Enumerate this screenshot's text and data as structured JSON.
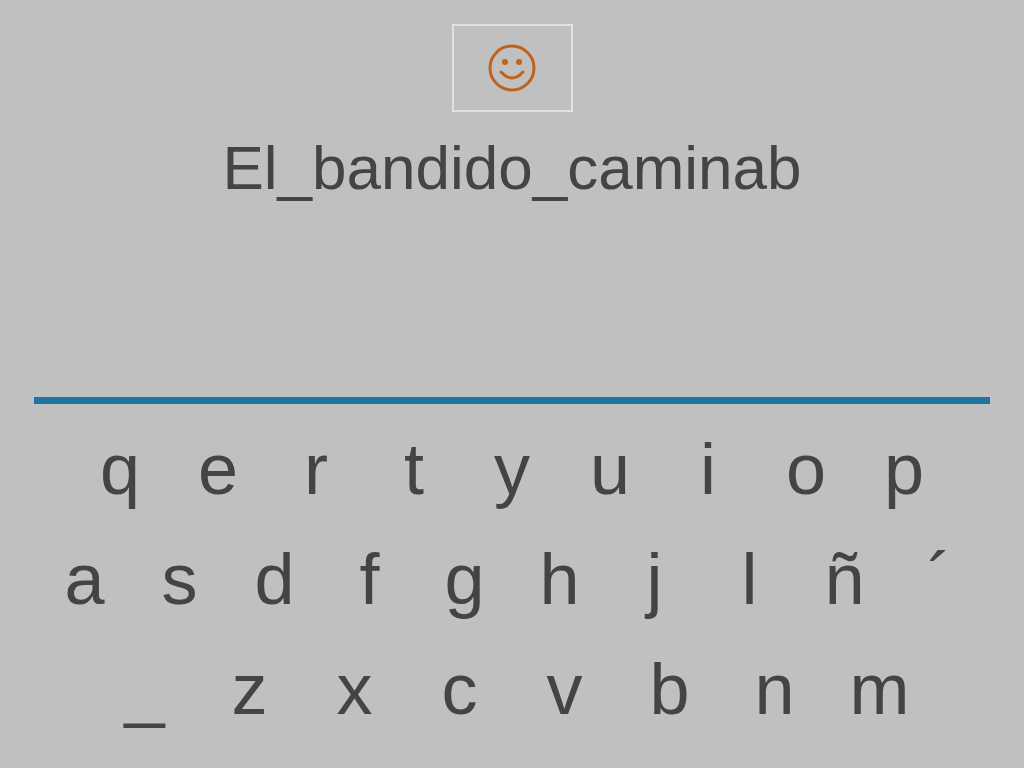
{
  "answer": {
    "text": "El_bandido_caminab"
  },
  "keyboard": {
    "rows": [
      [
        "q",
        "e",
        "r",
        "t",
        "y",
        "u",
        "i",
        "o",
        "p"
      ],
      [
        "a",
        "s",
        "d",
        "f",
        "g",
        "h",
        "j",
        "l",
        "ñ",
        "´"
      ],
      [
        "_",
        "z",
        "x",
        "c",
        "v",
        "b",
        "n",
        "m"
      ]
    ]
  }
}
